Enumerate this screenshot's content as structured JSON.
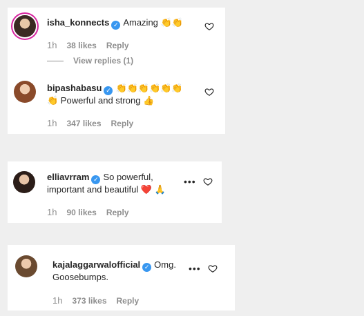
{
  "comments": [
    {
      "username": "isha_konnects",
      "text": "Amazing 👏👏",
      "time": "1h",
      "likes": "38 likes",
      "reply": "Reply",
      "view_replies": "View replies (1)"
    },
    {
      "username": "bipashabasu",
      "text_line1": "👏👏👏👏👏👏",
      "text_line2": "👏 Powerful and strong 👍",
      "time": "1h",
      "likes": "347 likes",
      "reply": "Reply"
    },
    {
      "username": "elliavrram",
      "text_line1": "So powerful,",
      "text_line2": "important and beautiful ❤️ 🙏",
      "time": "1h",
      "likes": "90 likes",
      "reply": "Reply"
    },
    {
      "username": "kajalaggarwalofficial",
      "text_line1": "Omg.",
      "text_line2": "Goosebumps.",
      "time": "1h",
      "likes": "373 likes",
      "reply": "Reply"
    }
  ],
  "icons": {
    "verified": "verified-badge-icon",
    "heart": "heart-outline-icon",
    "more": "more-options-icon"
  }
}
